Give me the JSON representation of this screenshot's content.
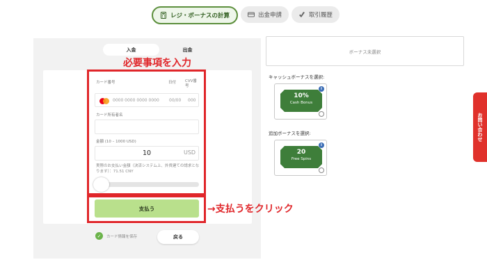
{
  "tabs": [
    {
      "label": "レジ・ボーナスの計算",
      "active": true,
      "icon": "calculator-icon"
    },
    {
      "label": "出金申請",
      "active": false,
      "icon": "withdraw-icon"
    },
    {
      "label": "取引履歴",
      "active": false,
      "icon": "history-icon"
    }
  ],
  "toggle": {
    "deposit": "入金",
    "withdraw": "出金"
  },
  "annotations": {
    "form_hint": "必要事項を入力",
    "pay_hint": "支払うをクリック"
  },
  "form": {
    "card_number_label": "カード番号",
    "date_label": "日付",
    "cvv_label": "CVV番号",
    "card_number_placeholder": "0000 0000 0000 0000",
    "date_placeholder": "00/00",
    "cvv_placeholder": "000",
    "holder_label": "カード所有者名",
    "holder_value": "",
    "amount_label": "金額 (10 – 1000 USD)",
    "amount_value": "10",
    "currency": "USD",
    "note": "実際のお支払い金額（決済システム上、外貨建ての請求となります）：71.51 CNY",
    "card_brand_icon": "mastercard-icon"
  },
  "pay_button": "支払う",
  "save_card_label": "カード情報を保存",
  "back_button": "戻る",
  "bonus_status": "ボーナス未選択",
  "cash_bonus": {
    "label": "キャッシュボーナスを選択:",
    "amount": "10%",
    "name": "Cash Bonus"
  },
  "extra_bonus": {
    "label": "追加ボーナスを選択:",
    "amount": "20",
    "name": "Free Spins"
  },
  "side_tab": "お問い合わせ",
  "colors": {
    "accent_green": "#5c8f3c",
    "pay_button": "#b9e08c",
    "annotation_red": "#e0262a",
    "ticket_green": "#3e7e3a"
  }
}
